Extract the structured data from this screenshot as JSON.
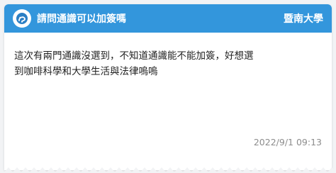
{
  "post": {
    "title": "請問通識可以加簽嗎",
    "board": "暨南大學",
    "body": "這次有兩門通識沒選到，不知道通識能不能加簽，好想選到咖啡科學和大學生活與法律嗚嗚",
    "date": "2022/9/1 09:13"
  },
  "colors": {
    "header": "#3396dc",
    "page_bg": "#f2f3f5"
  },
  "icons": {
    "avatar": "user-avatar-icon"
  }
}
